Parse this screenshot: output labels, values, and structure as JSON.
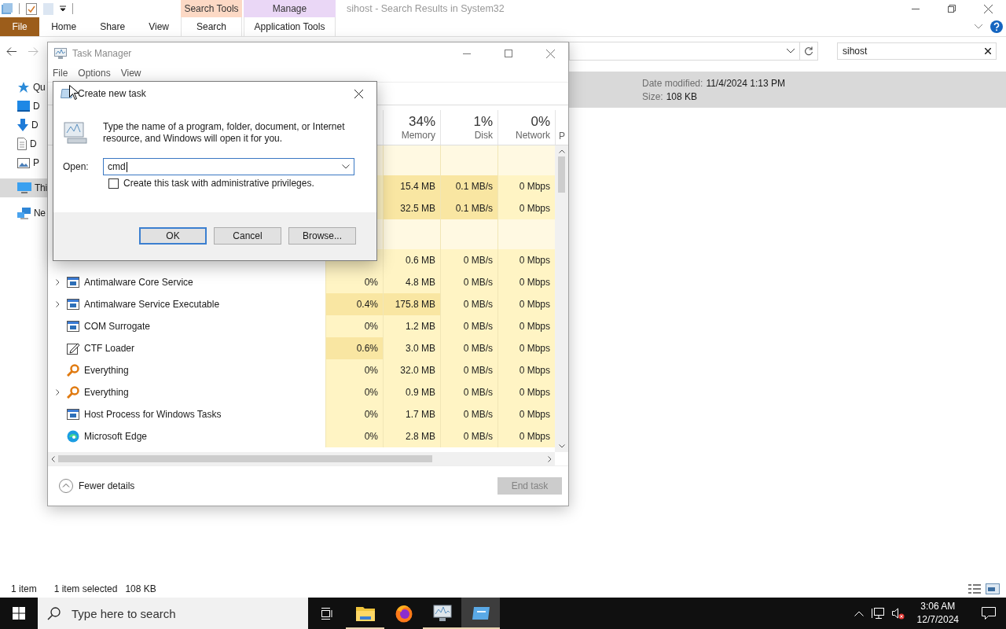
{
  "explorer": {
    "contextual_tabs": [
      {
        "group": "Search Tools",
        "tab": "Search",
        "color": "#fcd9c5"
      },
      {
        "group": "Manage",
        "tab": "Application Tools",
        "color": "#ead7f6"
      }
    ],
    "title": "sihost - Search Results in System32",
    "ribbon_tabs": [
      {
        "label": "File",
        "kind": "file"
      },
      {
        "label": "Home",
        "kind": "tab"
      },
      {
        "label": "Share",
        "kind": "tab"
      },
      {
        "label": "View",
        "kind": "tab"
      }
    ],
    "search": {
      "value": "sihost"
    },
    "nav_items": [
      {
        "label": "Qu",
        "kind": "star",
        "selected": false
      },
      {
        "label": "D",
        "kind": "desktop",
        "selected": false
      },
      {
        "label": "D",
        "kind": "download",
        "selected": false
      },
      {
        "label": "D",
        "kind": "document",
        "selected": false
      },
      {
        "label": "P",
        "kind": "picture",
        "selected": false
      },
      {
        "label": "Thi",
        "kind": "pc",
        "selected": true
      },
      {
        "label": "Ne",
        "kind": "network",
        "selected": false
      }
    ],
    "details": [
      {
        "label": "Date modified:",
        "value": "11/4/2024 1:13 PM"
      },
      {
        "label": "Size:",
        "value": "108 KB"
      }
    ],
    "status": [
      "1 item",
      "1 item selected",
      "108 KB"
    ]
  },
  "task_manager": {
    "title": "Task Manager",
    "menu": [
      "File",
      "Options",
      "View"
    ],
    "columns": [
      {
        "percent": "34%",
        "label": "Memory"
      },
      {
        "percent": "1%",
        "label": "Disk"
      },
      {
        "percent": "0%",
        "label": "Network"
      },
      {
        "label": "P"
      }
    ],
    "rows": [
      {
        "kind": "group"
      },
      {
        "kind": "values",
        "cells": [
          {
            "hot": false
          },
          {
            "text": "15.4 MB",
            "hot": true
          },
          {
            "text": "0.1 MB/s",
            "hot": true
          },
          {
            "text": "0 Mbps",
            "hot": false
          }
        ]
      },
      {
        "kind": "values",
        "cells": [
          {
            "hot": false
          },
          {
            "text": "32.5 MB",
            "hot": true
          },
          {
            "text": "0.1 MB/s",
            "hot": true
          },
          {
            "text": "0 Mbps",
            "hot": false
          }
        ]
      },
      {
        "kind": "group"
      },
      {
        "kind": "values",
        "cells": [
          {
            "hot": false
          },
          {
            "text": "0.6 MB",
            "hot": false
          },
          {
            "text": "0 MB/s",
            "hot": false
          },
          {
            "text": "0 Mbps",
            "hot": false
          }
        ]
      },
      {
        "kind": "window",
        "name": "Antimalware Core Service",
        "expandable": true,
        "cells": [
          {
            "text": "0%",
            "hot": false
          },
          {
            "text": "4.8 MB",
            "hot": false
          },
          {
            "text": "0 MB/s",
            "hot": false
          },
          {
            "text": "0 Mbps",
            "hot": false
          }
        ]
      },
      {
        "kind": "window",
        "name": "Antimalware Service Executable",
        "expandable": true,
        "cells": [
          {
            "text": "0.4%",
            "hot": true
          },
          {
            "text": "175.8 MB",
            "hot": true
          },
          {
            "text": "0 MB/s",
            "hot": false
          },
          {
            "text": "0 Mbps",
            "hot": false
          }
        ]
      },
      {
        "kind": "window",
        "name": "COM Surrogate",
        "expandable": false,
        "cells": [
          {
            "text": "0%",
            "hot": false
          },
          {
            "text": "1.2 MB",
            "hot": false
          },
          {
            "text": "0 MB/s",
            "hot": false
          },
          {
            "text": "0 Mbps",
            "hot": false
          }
        ]
      },
      {
        "kind": "pen",
        "name": "CTF Loader",
        "expandable": false,
        "cells": [
          {
            "text": "0.6%",
            "hot": true
          },
          {
            "text": "3.0 MB",
            "hot": false
          },
          {
            "text": "0 MB/s",
            "hot": false
          },
          {
            "text": "0 Mbps",
            "hot": false
          }
        ]
      },
      {
        "kind": "magnifier",
        "name": "Everything",
        "expandable": false,
        "cells": [
          {
            "text": "0%",
            "hot": false
          },
          {
            "text": "32.0 MB",
            "hot": false
          },
          {
            "text": "0 MB/s",
            "hot": false
          },
          {
            "text": "0 Mbps",
            "hot": false
          }
        ]
      },
      {
        "kind": "magnifier",
        "name": "Everything",
        "expandable": true,
        "cells": [
          {
            "text": "0%",
            "hot": false
          },
          {
            "text": "0.9 MB",
            "hot": false
          },
          {
            "text": "0 MB/s",
            "hot": false
          },
          {
            "text": "0 Mbps",
            "hot": false
          }
        ]
      },
      {
        "kind": "window",
        "name": "Host Process for Windows Tasks",
        "expandable": false,
        "cells": [
          {
            "text": "0%",
            "hot": false
          },
          {
            "text": "1.7 MB",
            "hot": false
          },
          {
            "text": "0 MB/s",
            "hot": false
          },
          {
            "text": "0 Mbps",
            "hot": false
          }
        ]
      },
      {
        "kind": "edge",
        "name": "Microsoft Edge",
        "expandable": false,
        "cells": [
          {
            "text": "0%",
            "hot": false
          },
          {
            "text": "2.8 MB",
            "hot": false
          },
          {
            "text": "0 MB/s",
            "hot": false
          },
          {
            "text": "0 Mbps",
            "hot": false
          }
        ]
      }
    ],
    "footer": {
      "toggle": "Fewer details",
      "end_task": {
        "label": "End task",
        "disabled": true
      }
    }
  },
  "dialog": {
    "title": "Create new task",
    "message": "Type the name of a program, folder, document, or Internet resource, and Windows will open it for you.",
    "open_label": "Open:",
    "value": "cmd",
    "admin": {
      "label": "Create this task with administrative privileges.",
      "checked": false
    },
    "buttons": [
      {
        "label": "OK",
        "default": true
      },
      {
        "label": "Cancel",
        "default": false
      },
      {
        "label": "Browse...",
        "default": false
      }
    ]
  },
  "taskbar": {
    "search_placeholder": "Type here to search",
    "apps": [
      {
        "kind": "explorer",
        "running": true,
        "selected": false
      },
      {
        "kind": "firefox",
        "running": false,
        "selected": false
      },
      {
        "kind": "taskmgr",
        "running": true,
        "selected": false
      },
      {
        "kind": "run",
        "running": true,
        "selected": true
      }
    ],
    "time": "3:06 AM",
    "date": "12/7/2024"
  }
}
